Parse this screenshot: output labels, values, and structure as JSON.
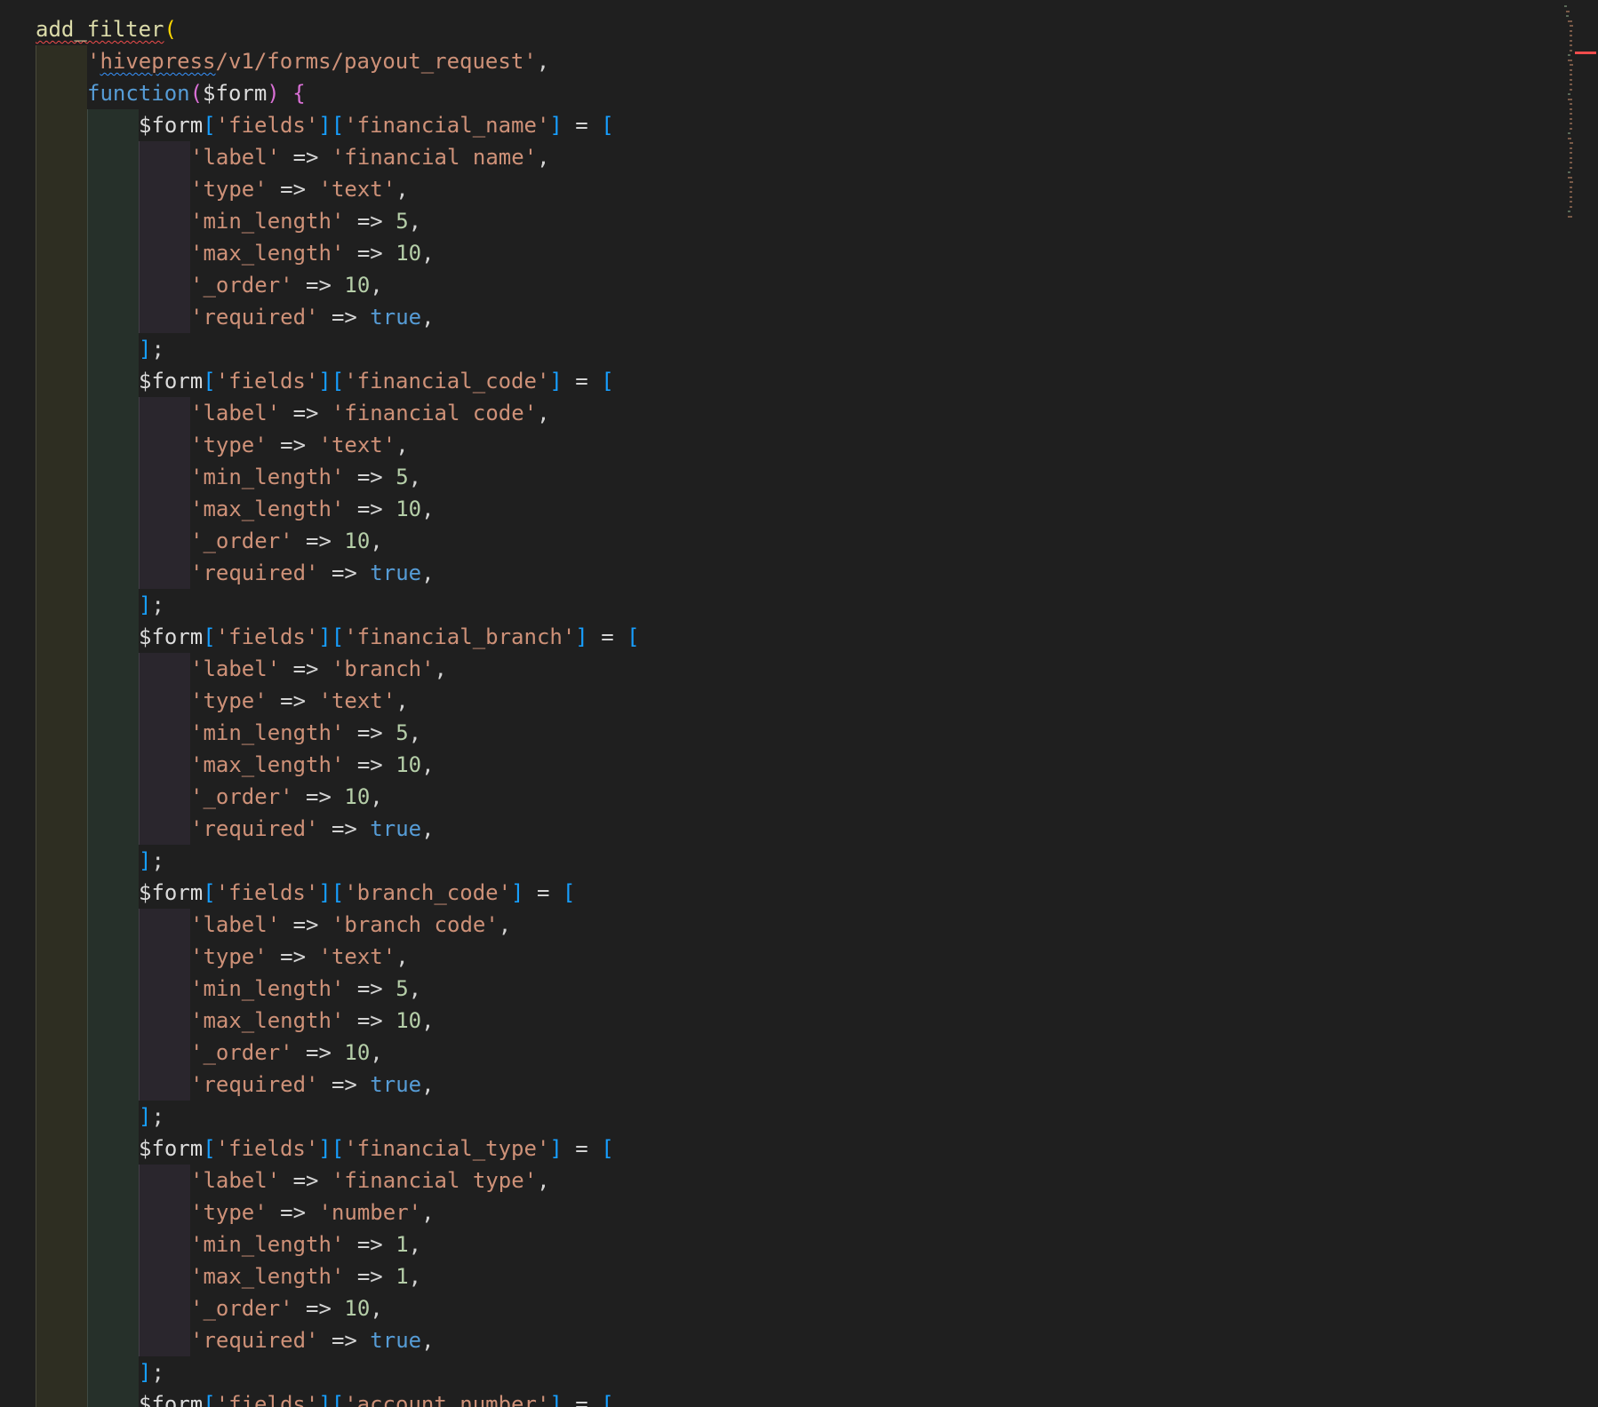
{
  "editor": {
    "colors": {
      "background": "#1f1f1f",
      "string": "#ce9178",
      "number": "#b5cea8",
      "keyword": "#569cd6",
      "function": "#dcdcaa",
      "error_squiggle": "#f14c4c",
      "info_squiggle": "#3794ff"
    },
    "lines": [
      [
        {
          "t": "add_filter",
          "c": "f",
          "u": "err"
        },
        {
          "t": "(",
          "c": "by"
        }
      ],
      [
        {
          "t": "'",
          "c": "s"
        },
        {
          "t": "hivepress",
          "c": "s",
          "u": "warn"
        },
        {
          "t": "/v1/forms/payout_request'",
          "c": "s"
        },
        {
          "t": ",",
          "c": "p"
        }
      ],
      [
        {
          "t": "function",
          "c": "kw"
        },
        {
          "t": "(",
          "c": "bp"
        },
        {
          "t": "$form",
          "c": "v"
        },
        {
          "t": ")",
          "c": "bp"
        },
        {
          "t": " ",
          "c": "p"
        },
        {
          "t": "{",
          "c": "bp"
        }
      ],
      [
        {
          "t": "$form",
          "c": "v"
        },
        {
          "t": "[",
          "c": "bb"
        },
        {
          "t": "'fields'",
          "c": "s"
        },
        {
          "t": "]",
          "c": "bb"
        },
        {
          "t": "[",
          "c": "bb"
        },
        {
          "t": "'financial_name'",
          "c": "s"
        },
        {
          "t": "]",
          "c": "bb"
        },
        {
          "t": " = ",
          "c": "p"
        },
        {
          "t": "[",
          "c": "bb"
        }
      ],
      [
        {
          "t": "'label'",
          "c": "s"
        },
        {
          "t": " => ",
          "c": "p"
        },
        {
          "t": "'financial name'",
          "c": "s"
        },
        {
          "t": ",",
          "c": "p"
        }
      ],
      [
        {
          "t": "'type'",
          "c": "s"
        },
        {
          "t": " => ",
          "c": "p"
        },
        {
          "t": "'text'",
          "c": "s"
        },
        {
          "t": ",",
          "c": "p"
        }
      ],
      [
        {
          "t": "'min_length'",
          "c": "s"
        },
        {
          "t": " => ",
          "c": "p"
        },
        {
          "t": "5",
          "c": "n"
        },
        {
          "t": ",",
          "c": "p"
        }
      ],
      [
        {
          "t": "'max_length'",
          "c": "s"
        },
        {
          "t": " => ",
          "c": "p"
        },
        {
          "t": "10",
          "c": "n"
        },
        {
          "t": ",",
          "c": "p"
        }
      ],
      [
        {
          "t": "'_order'",
          "c": "s"
        },
        {
          "t": " => ",
          "c": "p"
        },
        {
          "t": "10",
          "c": "n"
        },
        {
          "t": ",",
          "c": "p"
        }
      ],
      [
        {
          "t": "'required'",
          "c": "s"
        },
        {
          "t": " => ",
          "c": "p"
        },
        {
          "t": "true",
          "c": "k"
        },
        {
          "t": ",",
          "c": "p"
        }
      ],
      [
        {
          "t": "]",
          "c": "bb"
        },
        {
          "t": ";",
          "c": "p"
        }
      ],
      [
        {
          "t": "$form",
          "c": "v"
        },
        {
          "t": "[",
          "c": "bb"
        },
        {
          "t": "'fields'",
          "c": "s"
        },
        {
          "t": "]",
          "c": "bb"
        },
        {
          "t": "[",
          "c": "bb"
        },
        {
          "t": "'financial_code'",
          "c": "s"
        },
        {
          "t": "]",
          "c": "bb"
        },
        {
          "t": " = ",
          "c": "p"
        },
        {
          "t": "[",
          "c": "bb"
        }
      ],
      [
        {
          "t": "'label'",
          "c": "s"
        },
        {
          "t": " => ",
          "c": "p"
        },
        {
          "t": "'financial code'",
          "c": "s"
        },
        {
          "t": ",",
          "c": "p"
        }
      ],
      [
        {
          "t": "'type'",
          "c": "s"
        },
        {
          "t": " => ",
          "c": "p"
        },
        {
          "t": "'text'",
          "c": "s"
        },
        {
          "t": ",",
          "c": "p"
        }
      ],
      [
        {
          "t": "'min_length'",
          "c": "s"
        },
        {
          "t": " => ",
          "c": "p"
        },
        {
          "t": "5",
          "c": "n"
        },
        {
          "t": ",",
          "c": "p"
        }
      ],
      [
        {
          "t": "'max_length'",
          "c": "s"
        },
        {
          "t": " => ",
          "c": "p"
        },
        {
          "t": "10",
          "c": "n"
        },
        {
          "t": ",",
          "c": "p"
        }
      ],
      [
        {
          "t": "'_order'",
          "c": "s"
        },
        {
          "t": " => ",
          "c": "p"
        },
        {
          "t": "10",
          "c": "n"
        },
        {
          "t": ",",
          "c": "p"
        }
      ],
      [
        {
          "t": "'required'",
          "c": "s"
        },
        {
          "t": " => ",
          "c": "p"
        },
        {
          "t": "true",
          "c": "k"
        },
        {
          "t": ",",
          "c": "p"
        }
      ],
      [
        {
          "t": "]",
          "c": "bb"
        },
        {
          "t": ";",
          "c": "p"
        }
      ],
      [
        {
          "t": "$form",
          "c": "v"
        },
        {
          "t": "[",
          "c": "bb"
        },
        {
          "t": "'fields'",
          "c": "s"
        },
        {
          "t": "]",
          "c": "bb"
        },
        {
          "t": "[",
          "c": "bb"
        },
        {
          "t": "'financial_branch'",
          "c": "s"
        },
        {
          "t": "]",
          "c": "bb"
        },
        {
          "t": " = ",
          "c": "p"
        },
        {
          "t": "[",
          "c": "bb"
        }
      ],
      [
        {
          "t": "'label'",
          "c": "s"
        },
        {
          "t": " => ",
          "c": "p"
        },
        {
          "t": "'branch'",
          "c": "s"
        },
        {
          "t": ",",
          "c": "p"
        }
      ],
      [
        {
          "t": "'type'",
          "c": "s"
        },
        {
          "t": " => ",
          "c": "p"
        },
        {
          "t": "'text'",
          "c": "s"
        },
        {
          "t": ",",
          "c": "p"
        }
      ],
      [
        {
          "t": "'min_length'",
          "c": "s"
        },
        {
          "t": " => ",
          "c": "p"
        },
        {
          "t": "5",
          "c": "n"
        },
        {
          "t": ",",
          "c": "p"
        }
      ],
      [
        {
          "t": "'max_length'",
          "c": "s"
        },
        {
          "t": " => ",
          "c": "p"
        },
        {
          "t": "10",
          "c": "n"
        },
        {
          "t": ",",
          "c": "p"
        }
      ],
      [
        {
          "t": "'_order'",
          "c": "s"
        },
        {
          "t": " => ",
          "c": "p"
        },
        {
          "t": "10",
          "c": "n"
        },
        {
          "t": ",",
          "c": "p"
        }
      ],
      [
        {
          "t": "'required'",
          "c": "s"
        },
        {
          "t": " => ",
          "c": "p"
        },
        {
          "t": "true",
          "c": "k"
        },
        {
          "t": ",",
          "c": "p"
        }
      ],
      [
        {
          "t": "]",
          "c": "bb"
        },
        {
          "t": ";",
          "c": "p"
        }
      ],
      [
        {
          "t": "$form",
          "c": "v"
        },
        {
          "t": "[",
          "c": "bb"
        },
        {
          "t": "'fields'",
          "c": "s"
        },
        {
          "t": "]",
          "c": "bb"
        },
        {
          "t": "[",
          "c": "bb"
        },
        {
          "t": "'branch_code'",
          "c": "s"
        },
        {
          "t": "]",
          "c": "bb"
        },
        {
          "t": " = ",
          "c": "p"
        },
        {
          "t": "[",
          "c": "bb"
        }
      ],
      [
        {
          "t": "'label'",
          "c": "s"
        },
        {
          "t": " => ",
          "c": "p"
        },
        {
          "t": "'branch code'",
          "c": "s"
        },
        {
          "t": ",",
          "c": "p"
        }
      ],
      [
        {
          "t": "'type'",
          "c": "s"
        },
        {
          "t": " => ",
          "c": "p"
        },
        {
          "t": "'text'",
          "c": "s"
        },
        {
          "t": ",",
          "c": "p"
        }
      ],
      [
        {
          "t": "'min_length'",
          "c": "s"
        },
        {
          "t": " => ",
          "c": "p"
        },
        {
          "t": "5",
          "c": "n"
        },
        {
          "t": ",",
          "c": "p"
        }
      ],
      [
        {
          "t": "'max_length'",
          "c": "s"
        },
        {
          "t": " => ",
          "c": "p"
        },
        {
          "t": "10",
          "c": "n"
        },
        {
          "t": ",",
          "c": "p"
        }
      ],
      [
        {
          "t": "'_order'",
          "c": "s"
        },
        {
          "t": " => ",
          "c": "p"
        },
        {
          "t": "10",
          "c": "n"
        },
        {
          "t": ",",
          "c": "p"
        }
      ],
      [
        {
          "t": "'required'",
          "c": "s"
        },
        {
          "t": " => ",
          "c": "p"
        },
        {
          "t": "true",
          "c": "k"
        },
        {
          "t": ",",
          "c": "p"
        }
      ],
      [
        {
          "t": "]",
          "c": "bb"
        },
        {
          "t": ";",
          "c": "p"
        }
      ],
      [
        {
          "t": "$form",
          "c": "v"
        },
        {
          "t": "[",
          "c": "bb"
        },
        {
          "t": "'fields'",
          "c": "s"
        },
        {
          "t": "]",
          "c": "bb"
        },
        {
          "t": "[",
          "c": "bb"
        },
        {
          "t": "'financial_type'",
          "c": "s"
        },
        {
          "t": "]",
          "c": "bb"
        },
        {
          "t": " = ",
          "c": "p"
        },
        {
          "t": "[",
          "c": "bb"
        }
      ],
      [
        {
          "t": "'label'",
          "c": "s"
        },
        {
          "t": " => ",
          "c": "p"
        },
        {
          "t": "'financial type'",
          "c": "s"
        },
        {
          "t": ",",
          "c": "p"
        }
      ],
      [
        {
          "t": "'type'",
          "c": "s"
        },
        {
          "t": " => ",
          "c": "p"
        },
        {
          "t": "'number'",
          "c": "s"
        },
        {
          "t": ",",
          "c": "p"
        }
      ],
      [
        {
          "t": "'min_length'",
          "c": "s"
        },
        {
          "t": " => ",
          "c": "p"
        },
        {
          "t": "1",
          "c": "n"
        },
        {
          "t": ",",
          "c": "p"
        }
      ],
      [
        {
          "t": "'max_length'",
          "c": "s"
        },
        {
          "t": " => ",
          "c": "p"
        },
        {
          "t": "1",
          "c": "n"
        },
        {
          "t": ",",
          "c": "p"
        }
      ],
      [
        {
          "t": "'_order'",
          "c": "s"
        },
        {
          "t": " => ",
          "c": "p"
        },
        {
          "t": "10",
          "c": "n"
        },
        {
          "t": ",",
          "c": "p"
        }
      ],
      [
        {
          "t": "'required'",
          "c": "s"
        },
        {
          "t": " => ",
          "c": "p"
        },
        {
          "t": "true",
          "c": "k"
        },
        {
          "t": ",",
          "c": "p"
        }
      ],
      [
        {
          "t": "]",
          "c": "bb"
        },
        {
          "t": ";",
          "c": "p"
        }
      ],
      [
        {
          "t": "$form",
          "c": "v"
        },
        {
          "t": "[",
          "c": "bb"
        },
        {
          "t": "'fields'",
          "c": "s"
        },
        {
          "t": "]",
          "c": "bb"
        },
        {
          "t": "[",
          "c": "bb"
        },
        {
          "t": "'account_number'",
          "c": "s"
        },
        {
          "t": "]",
          "c": "bb"
        },
        {
          "t": " = ",
          "c": "p"
        },
        {
          "t": "[",
          "c": "bb"
        }
      ]
    ]
  }
}
